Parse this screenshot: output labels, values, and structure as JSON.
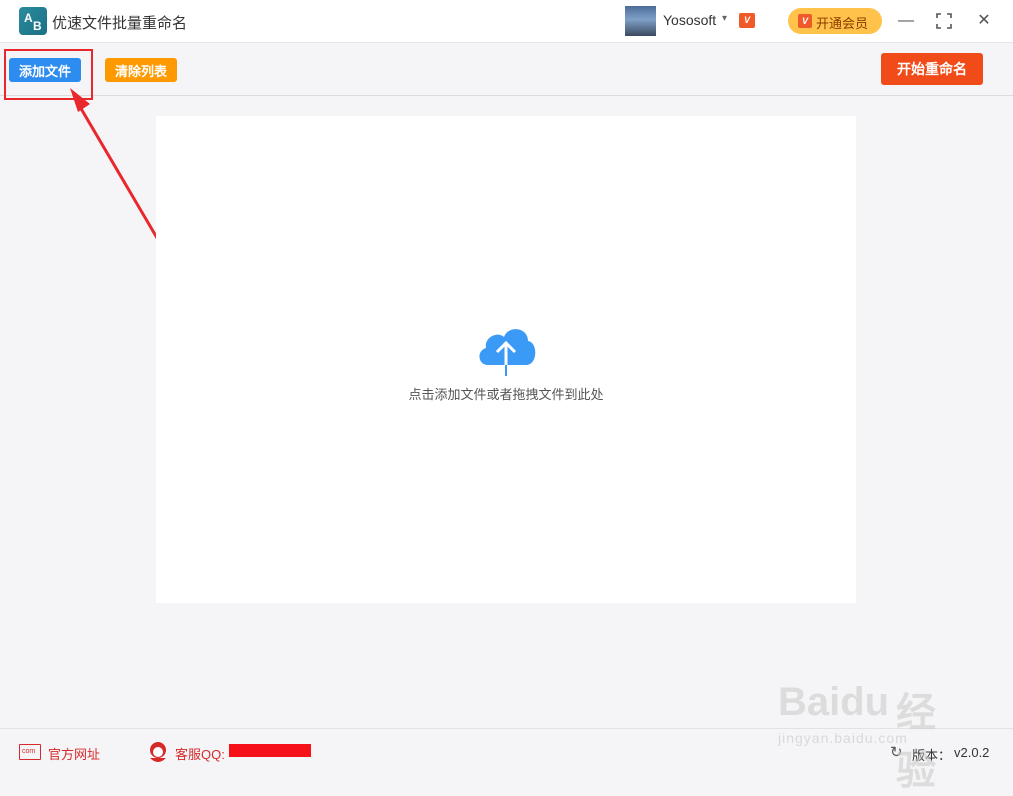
{
  "app": {
    "title": "优速文件批量重命名",
    "logo_text": [
      "A",
      "B"
    ]
  },
  "user": {
    "name": "Yososoft",
    "vip_badge": "V"
  },
  "member_button": {
    "label": "开通会员",
    "badge": "V"
  },
  "window_controls": {
    "minimize": "—",
    "maximize": "⛶",
    "close": "✕"
  },
  "toolbar": {
    "add_files": "添加文件",
    "clear_list": "清除列表",
    "start_rename": "开始重命名"
  },
  "dropzone": {
    "hint": "点击添加文件或者拖拽文件到此处"
  },
  "footer": {
    "website_icon_text": "com",
    "website_label": "官方网址",
    "support_label": "客服QQ:",
    "version_label": "版本：",
    "version_value": "v2.0.2"
  },
  "watermark": {
    "brand": "Baidu",
    "cn": "经验",
    "sub": "jingyan.baidu.com"
  },
  "colors": {
    "add_button": "#2d8cf0",
    "clear_button": "#ff9900",
    "start_button": "#f04b18",
    "annotation": "#e8282c",
    "cloud": "#3a9af5"
  },
  "icons": {
    "app_logo": "ab-logo-icon",
    "cloud": "cloud-upload-icon",
    "website": "website-com-icon",
    "support": "customer-service-icon",
    "refresh": "refresh-icon"
  }
}
